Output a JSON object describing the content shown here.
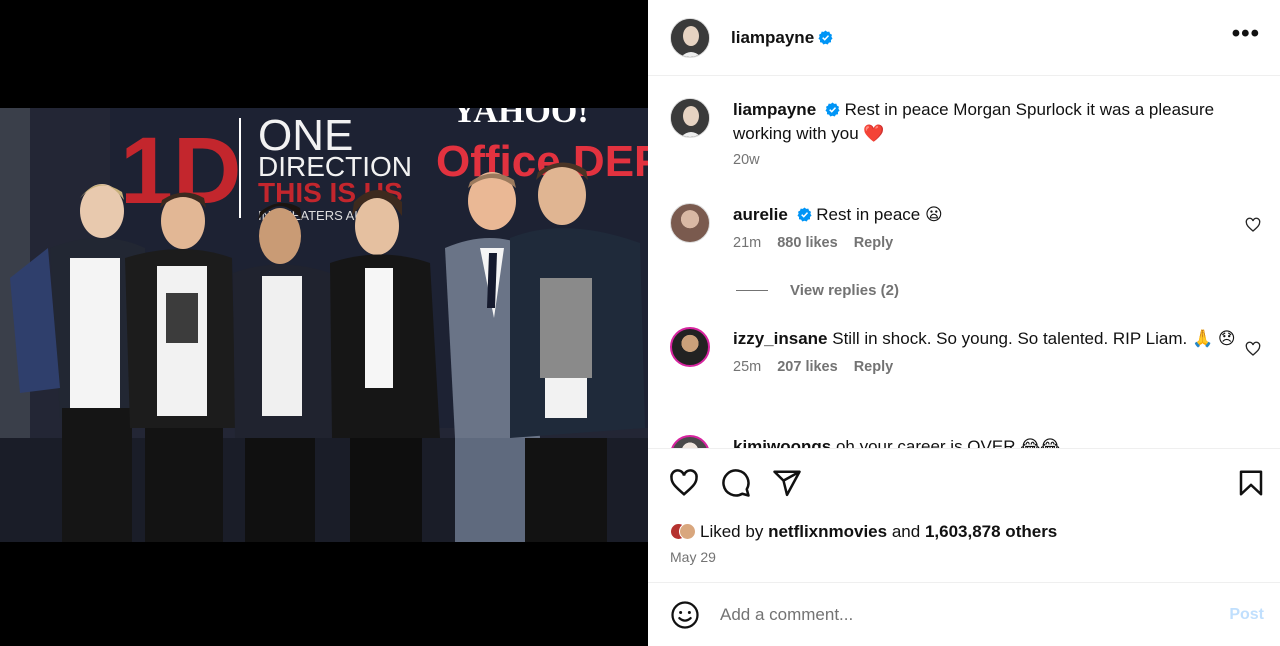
{
  "post": {
    "author": "liampayne",
    "caption_text": "Rest in peace Morgan Spurlock it was a pleasure working with you",
    "caption_emoji": "❤️",
    "caption_age": "20w"
  },
  "photo": {
    "sign_band": "ONE",
    "sign_band_2": "DIRECTION",
    "sign_title": "THIS IS US",
    "sign_date": "IN THEATERS AUG",
    "sign_sponsor": "YAHOO!",
    "sign_store": "Office DEPOT"
  },
  "comments": [
    {
      "user": "aurelie",
      "verified": true,
      "text": "Rest in peace",
      "emoji": "😦",
      "age": "21m",
      "likes": "880 likes",
      "reply": "Reply"
    },
    {
      "user": "izzy_insane",
      "verified": false,
      "text": "Still in shock. So young. So talented. RIP Liam.",
      "emoji": "🙏 😞",
      "age": "25m",
      "likes": "207 likes",
      "reply": "Reply"
    },
    {
      "user": "kimiwoongs",
      "verified": false,
      "text": "oh your career is OVER",
      "emoji": "😂😂"
    }
  ],
  "view_replies": "View replies (2)",
  "likes": {
    "prefix": "Liked by",
    "by": "netflixnmovies",
    "and": "and",
    "count": "1,603,878 others"
  },
  "date": "May 29",
  "comment_box": {
    "placeholder": "Add a comment...",
    "post_label": "Post"
  },
  "icons": [
    "heart-icon",
    "comment-icon",
    "share-icon",
    "bookmark-icon",
    "more-icon",
    "emoji-icon",
    "verified-icon"
  ],
  "colors": {
    "verified": "#0095f6",
    "heart": "#ff3040",
    "post_disabled": "#c0dffd",
    "muted": "#737373"
  }
}
